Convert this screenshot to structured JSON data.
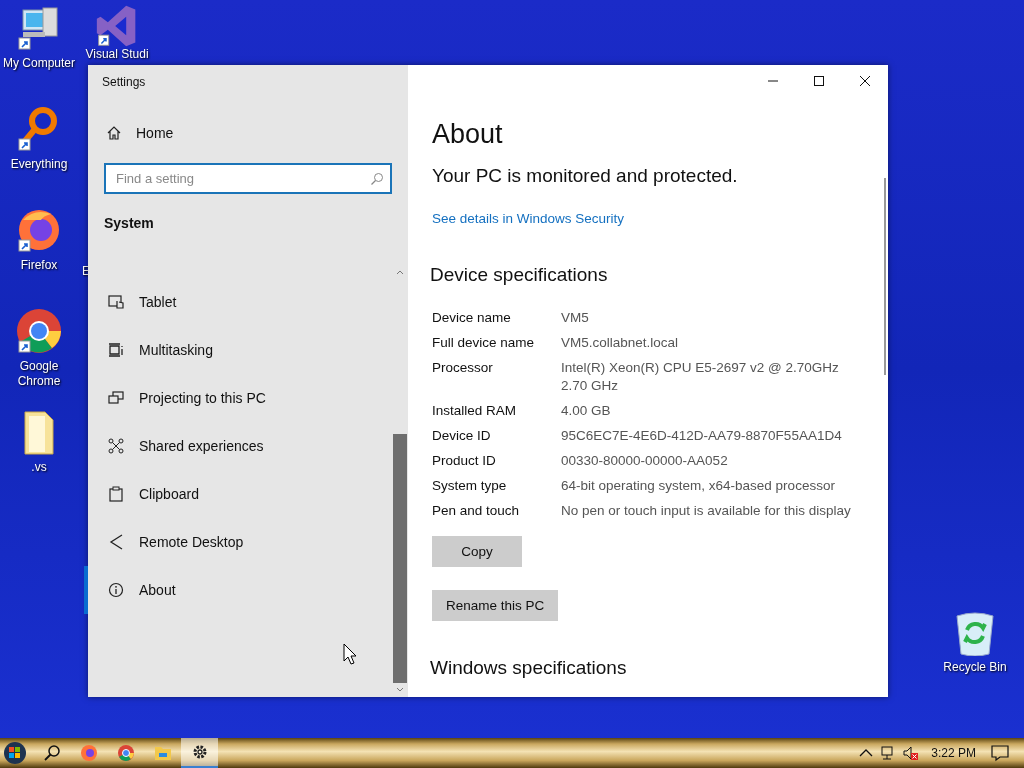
{
  "desktop_icons": [
    {
      "label": "My Computer",
      "kind": "computer"
    },
    {
      "label": "Everything",
      "kind": "magnifier"
    },
    {
      "label": "Firefox",
      "kind": "firefox"
    },
    {
      "label": "Google Chrome",
      "kind": "chrome"
    },
    {
      "label": ".vs",
      "kind": "folder"
    },
    {
      "label": "Visual Studi",
      "kind": "studio"
    },
    {
      "label": "E",
      "kind": "covered"
    },
    {
      "label": "Recycle Bin",
      "kind": "recycle"
    }
  ],
  "window": {
    "title": "Settings",
    "sidebar": {
      "home": "Home",
      "search": {
        "placeholder": "Find a setting"
      },
      "section": "System",
      "items": [
        {
          "label": "Tablet",
          "kind": "tablet",
          "selected": false
        },
        {
          "label": "Multitasking",
          "kind": "multitasking",
          "selected": false
        },
        {
          "label": "Projecting to this PC",
          "kind": "projecting",
          "selected": false
        },
        {
          "label": "Shared experiences",
          "kind": "shared",
          "selected": false
        },
        {
          "label": "Clipboard",
          "kind": "clipboard",
          "selected": false
        },
        {
          "label": "Remote Desktop",
          "kind": "remote",
          "selected": false
        },
        {
          "label": "About",
          "kind": "about",
          "selected": true
        }
      ]
    },
    "content": {
      "heading": "About",
      "status": "Your PC is monitored and protected.",
      "link": "See details in Windows Security",
      "specs_heading": "Device specifications",
      "specs": [
        {
          "label": "Device name",
          "value": "VM5"
        },
        {
          "label": "Full device name",
          "value": "VM5.collabnet.local"
        },
        {
          "label": "Processor",
          "value": "Intel(R) Xeon(R) CPU E5-2697 v2 @ 2.70GHz\n2.70 GHz"
        },
        {
          "label": "Installed RAM",
          "value": "4.00 GB"
        },
        {
          "label": "Device ID",
          "value": "95C6EC7E-4E6D-412D-AA79-8870F55AA1D4"
        },
        {
          "label": "Product ID",
          "value": "00330-80000-00000-AA052"
        },
        {
          "label": "System type",
          "value": "64-bit operating system, x64-based processor"
        },
        {
          "label": "Pen and touch",
          "value": "No pen or touch input is available for this display"
        }
      ],
      "copy_button": "Copy",
      "rename_button": "Rename this PC",
      "next_heading": "Windows specifications"
    }
  },
  "taskbar": {
    "apps": [
      {
        "kind": "search",
        "active": false
      },
      {
        "kind": "firefox",
        "active": false
      },
      {
        "kind": "chrome",
        "active": false
      },
      {
        "kind": "explorer",
        "active": false
      },
      {
        "kind": "settings",
        "active": true
      }
    ],
    "tray": [
      {
        "kind": "chevron"
      },
      {
        "kind": "network"
      },
      {
        "kind": "volume-muted"
      }
    ],
    "clock": "3:22 PM"
  }
}
